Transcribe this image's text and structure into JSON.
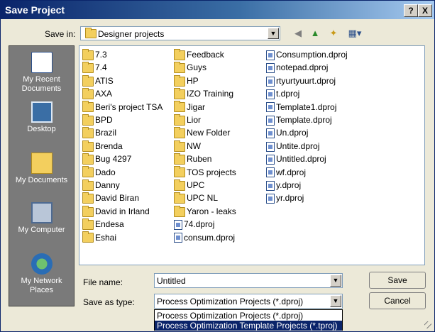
{
  "title": "Save Project",
  "help_button": "?",
  "close_button": "X",
  "save_in_label": "Save in:",
  "save_in_value": "Designer projects",
  "places": [
    {
      "label": "My Recent\nDocuments",
      "icon": "recent-documents-icon"
    },
    {
      "label": "Desktop",
      "icon": "desktop-icon"
    },
    {
      "label": "My Documents",
      "icon": "my-documents-icon"
    },
    {
      "label": "My Computer",
      "icon": "my-computer-icon"
    },
    {
      "label": "My Network\nPlaces",
      "icon": "network-places-icon"
    }
  ],
  "files": {
    "col1": [
      "7.3",
      "7.4",
      "ATIS",
      "AXA",
      "Beri's project TSA",
      "BPD",
      "Brazil",
      "Brenda",
      "Bug 4297",
      "Dado",
      "Danny",
      "David Biran",
      "David in Irland",
      "Endesa",
      "Eshai"
    ],
    "col2_folders": [
      "Feedback",
      "Guys",
      "HP",
      "IZO Training",
      "Jigar",
      "Lior",
      "New Folder",
      "NW",
      "Ruben",
      "TOS projects",
      "UPC",
      "UPC NL",
      "Yaron - leaks"
    ],
    "col2_files": [
      "74.dproj",
      "consum.dproj"
    ],
    "col3": [
      "Consumption.dproj",
      "notepad.dproj",
      "rtyurtyuurt.dproj",
      "t.dproj",
      "Template1.dproj",
      "Template.dproj",
      "Un.dproj",
      "Untite.dproj",
      "Untitled.dproj",
      "wf.dproj",
      "y.dproj",
      "yr.dproj"
    ]
  },
  "file_name_label": "File name:",
  "file_name_value": "Untitled",
  "save_type_label": "Save as type:",
  "save_type_value": "Process Optimization Projects (*.dproj)",
  "type_options": [
    "Process Optimization Projects (*.dproj)",
    "Process Optimization Template Projects (*.tproj)"
  ],
  "save_button": "Save",
  "cancel_button": "Cancel"
}
